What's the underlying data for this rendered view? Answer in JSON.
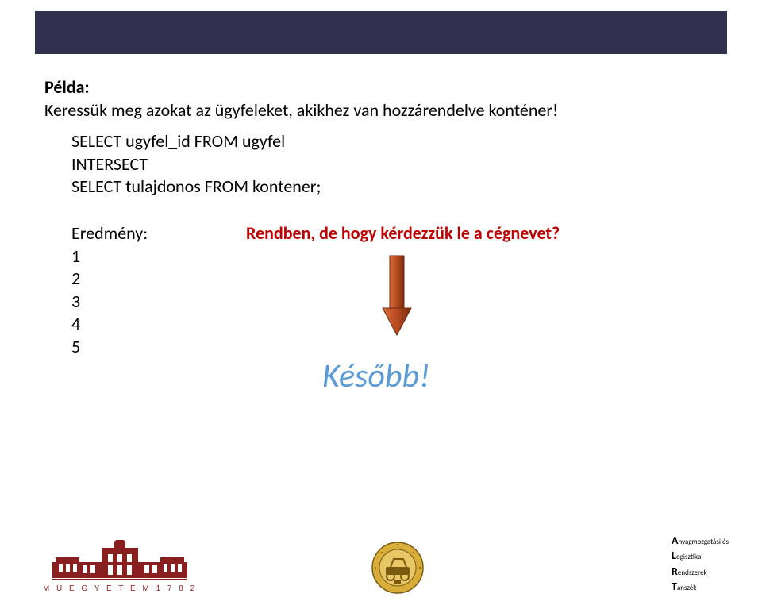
{
  "heading": {
    "title": "Példa:",
    "subtitle": "Keressük meg azokat az ügyfeleket, akikhez van hozzárendelve konténer!"
  },
  "sql": {
    "line1": "SELECT ugyfel_id FROM ugyfel",
    "line2": "INTERSECT",
    "line3": "SELECT tulajdonos FROM kontener;"
  },
  "result": {
    "label": "Eredmény:",
    "r1": "1",
    "r2": "2",
    "r3": "3",
    "r4": "4",
    "r5": "5"
  },
  "question": "Rendben, de hogy kérdezzük le a cégnevet?",
  "later": "Később!",
  "dept": {
    "A": "A",
    "Atext": "nyagmozgatási és",
    "L": "L",
    "Ltext": "ogisztikai",
    "R": "R",
    "Rtext": "endszerek",
    "T": "T",
    "Ttext": "anszék"
  },
  "logo_left_caption": "M Ű E G Y E T E M   1 7 8 2"
}
